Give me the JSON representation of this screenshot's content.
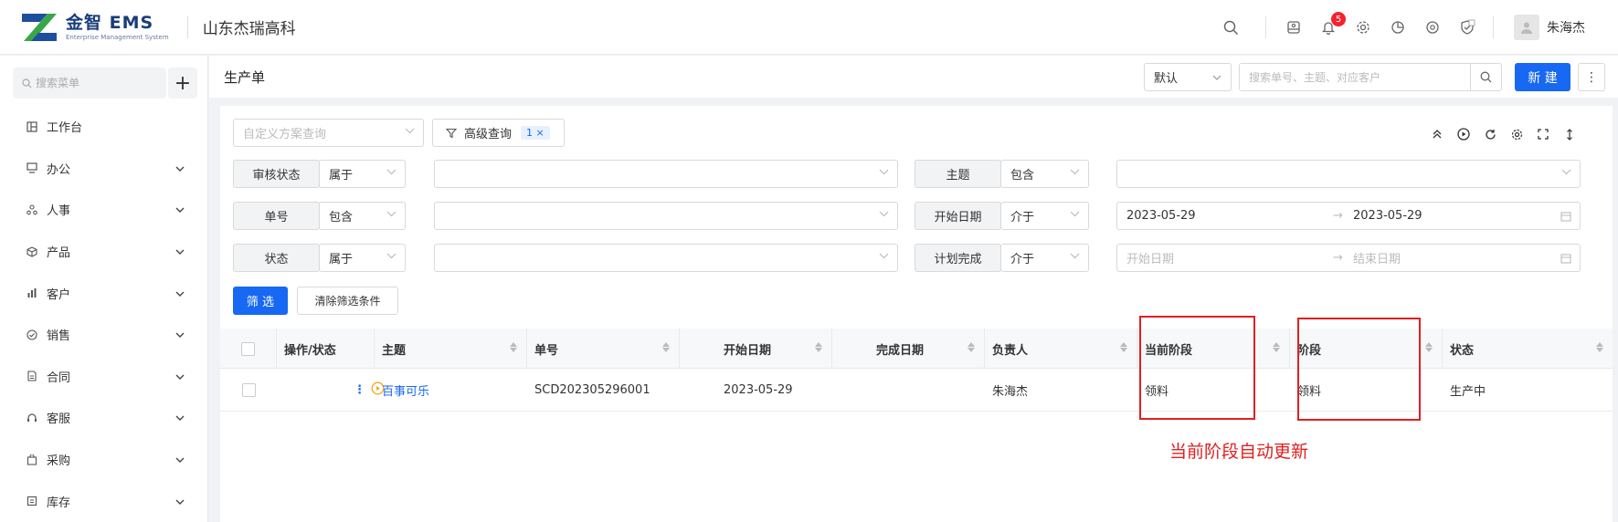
{
  "header": {
    "logo_title": "金智 EMS",
    "logo_subtitle": "Enterprise Management System",
    "company": "山东杰瑞高科",
    "notification_count": "5",
    "user_name": "朱海杰"
  },
  "sidebar": {
    "search_placeholder": "搜索菜单",
    "add_label": "+",
    "items": [
      {
        "label": "工作台",
        "icon": "dashboard-icon",
        "has_children": false
      },
      {
        "label": "办公",
        "icon": "office-icon",
        "has_children": true
      },
      {
        "label": "人事",
        "icon": "people-icon",
        "has_children": true
      },
      {
        "label": "产品",
        "icon": "box-icon",
        "has_children": true
      },
      {
        "label": "客户",
        "icon": "customer-icon",
        "has_children": true
      },
      {
        "label": "销售",
        "icon": "sales-icon",
        "has_children": true
      },
      {
        "label": "合同",
        "icon": "contract-icon",
        "has_children": true
      },
      {
        "label": "客服",
        "icon": "headset-icon",
        "has_children": true
      },
      {
        "label": "采购",
        "icon": "purchase-icon",
        "has_children": true
      },
      {
        "label": "库存",
        "icon": "warehouse-icon",
        "has_children": true
      }
    ]
  },
  "page": {
    "title": "生产单",
    "view_select": "默认",
    "search_placeholder": "搜索单号、主题、对应客户",
    "new_button": "新 建",
    "more_button": "⋮"
  },
  "filters": {
    "scheme_placeholder": "自定义方案查询",
    "advanced_label": "高级查询",
    "advanced_count": "1 ×",
    "rows": [
      {
        "label": "审核状态",
        "op": "属于",
        "value": ""
      },
      {
        "label": "单号",
        "op": "包含",
        "value": ""
      },
      {
        "label": "状态",
        "op": "属于",
        "value": ""
      }
    ],
    "right_rows": [
      {
        "label": "主题",
        "op": "包含",
        "value": ""
      },
      {
        "label": "开始日期",
        "op": "介于",
        "from": "2023-05-29",
        "to": "2023-05-29",
        "from_placeholder": "",
        "to_placeholder": ""
      },
      {
        "label": "计划完成",
        "op": "介于",
        "from": "",
        "to": "",
        "from_placeholder": "开始日期",
        "to_placeholder": "结束日期"
      }
    ],
    "arrow": "→",
    "filter_button": "筛 选",
    "clear_button": "清除筛选条件"
  },
  "table": {
    "columns": [
      "操作/状态",
      "主题",
      "单号",
      "开始日期",
      "完成日期",
      "负责人",
      "当前阶段",
      "阶段",
      "状态"
    ],
    "rows": [
      {
        "action": "⋮",
        "subject": "百事可乐",
        "number": "SCD202305296001",
        "start_date": "2023-05-29",
        "finish_date": "",
        "owner": "朱海杰",
        "current_stage": "领料",
        "stage": "领料",
        "status": "生产中"
      }
    ]
  },
  "annotation": {
    "text": "当前阶段自动更新",
    "color": "#e02020"
  },
  "colors": {
    "primary": "#1768f2",
    "annotation": "#e02020"
  }
}
